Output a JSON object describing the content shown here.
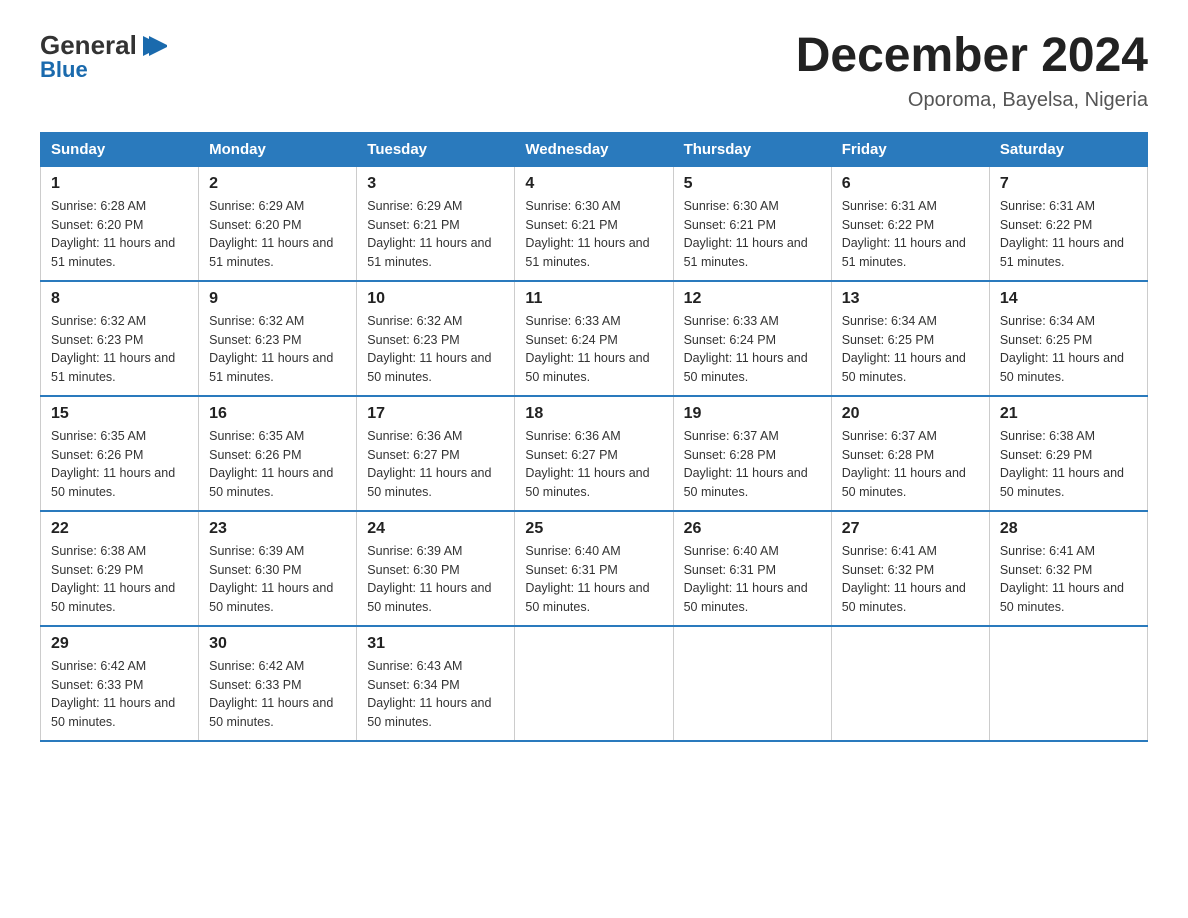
{
  "logo": {
    "text_general": "General",
    "text_blue": "Blue",
    "aria": "GeneralBlue logo"
  },
  "header": {
    "title": "December 2024",
    "subtitle": "Oporoma, Bayelsa, Nigeria"
  },
  "weekdays": [
    "Sunday",
    "Monday",
    "Tuesday",
    "Wednesday",
    "Thursday",
    "Friday",
    "Saturday"
  ],
  "weeks": [
    [
      {
        "day": "1",
        "sunrise": "6:28 AM",
        "sunset": "6:20 PM",
        "daylight": "11 hours and 51 minutes."
      },
      {
        "day": "2",
        "sunrise": "6:29 AM",
        "sunset": "6:20 PM",
        "daylight": "11 hours and 51 minutes."
      },
      {
        "day": "3",
        "sunrise": "6:29 AM",
        "sunset": "6:21 PM",
        "daylight": "11 hours and 51 minutes."
      },
      {
        "day": "4",
        "sunrise": "6:30 AM",
        "sunset": "6:21 PM",
        "daylight": "11 hours and 51 minutes."
      },
      {
        "day": "5",
        "sunrise": "6:30 AM",
        "sunset": "6:21 PM",
        "daylight": "11 hours and 51 minutes."
      },
      {
        "day": "6",
        "sunrise": "6:31 AM",
        "sunset": "6:22 PM",
        "daylight": "11 hours and 51 minutes."
      },
      {
        "day": "7",
        "sunrise": "6:31 AM",
        "sunset": "6:22 PM",
        "daylight": "11 hours and 51 minutes."
      }
    ],
    [
      {
        "day": "8",
        "sunrise": "6:32 AM",
        "sunset": "6:23 PM",
        "daylight": "11 hours and 51 minutes."
      },
      {
        "day": "9",
        "sunrise": "6:32 AM",
        "sunset": "6:23 PM",
        "daylight": "11 hours and 51 minutes."
      },
      {
        "day": "10",
        "sunrise": "6:32 AM",
        "sunset": "6:23 PM",
        "daylight": "11 hours and 50 minutes."
      },
      {
        "day": "11",
        "sunrise": "6:33 AM",
        "sunset": "6:24 PM",
        "daylight": "11 hours and 50 minutes."
      },
      {
        "day": "12",
        "sunrise": "6:33 AM",
        "sunset": "6:24 PM",
        "daylight": "11 hours and 50 minutes."
      },
      {
        "day": "13",
        "sunrise": "6:34 AM",
        "sunset": "6:25 PM",
        "daylight": "11 hours and 50 minutes."
      },
      {
        "day": "14",
        "sunrise": "6:34 AM",
        "sunset": "6:25 PM",
        "daylight": "11 hours and 50 minutes."
      }
    ],
    [
      {
        "day": "15",
        "sunrise": "6:35 AM",
        "sunset": "6:26 PM",
        "daylight": "11 hours and 50 minutes."
      },
      {
        "day": "16",
        "sunrise": "6:35 AM",
        "sunset": "6:26 PM",
        "daylight": "11 hours and 50 minutes."
      },
      {
        "day": "17",
        "sunrise": "6:36 AM",
        "sunset": "6:27 PM",
        "daylight": "11 hours and 50 minutes."
      },
      {
        "day": "18",
        "sunrise": "6:36 AM",
        "sunset": "6:27 PM",
        "daylight": "11 hours and 50 minutes."
      },
      {
        "day": "19",
        "sunrise": "6:37 AM",
        "sunset": "6:28 PM",
        "daylight": "11 hours and 50 minutes."
      },
      {
        "day": "20",
        "sunrise": "6:37 AM",
        "sunset": "6:28 PM",
        "daylight": "11 hours and 50 minutes."
      },
      {
        "day": "21",
        "sunrise": "6:38 AM",
        "sunset": "6:29 PM",
        "daylight": "11 hours and 50 minutes."
      }
    ],
    [
      {
        "day": "22",
        "sunrise": "6:38 AM",
        "sunset": "6:29 PM",
        "daylight": "11 hours and 50 minutes."
      },
      {
        "day": "23",
        "sunrise": "6:39 AM",
        "sunset": "6:30 PM",
        "daylight": "11 hours and 50 minutes."
      },
      {
        "day": "24",
        "sunrise": "6:39 AM",
        "sunset": "6:30 PM",
        "daylight": "11 hours and 50 minutes."
      },
      {
        "day": "25",
        "sunrise": "6:40 AM",
        "sunset": "6:31 PM",
        "daylight": "11 hours and 50 minutes."
      },
      {
        "day": "26",
        "sunrise": "6:40 AM",
        "sunset": "6:31 PM",
        "daylight": "11 hours and 50 minutes."
      },
      {
        "day": "27",
        "sunrise": "6:41 AM",
        "sunset": "6:32 PM",
        "daylight": "11 hours and 50 minutes."
      },
      {
        "day": "28",
        "sunrise": "6:41 AM",
        "sunset": "6:32 PM",
        "daylight": "11 hours and 50 minutes."
      }
    ],
    [
      {
        "day": "29",
        "sunrise": "6:42 AM",
        "sunset": "6:33 PM",
        "daylight": "11 hours and 50 minutes."
      },
      {
        "day": "30",
        "sunrise": "6:42 AM",
        "sunset": "6:33 PM",
        "daylight": "11 hours and 50 minutes."
      },
      {
        "day": "31",
        "sunrise": "6:43 AM",
        "sunset": "6:34 PM",
        "daylight": "11 hours and 50 minutes."
      },
      null,
      null,
      null,
      null
    ]
  ]
}
